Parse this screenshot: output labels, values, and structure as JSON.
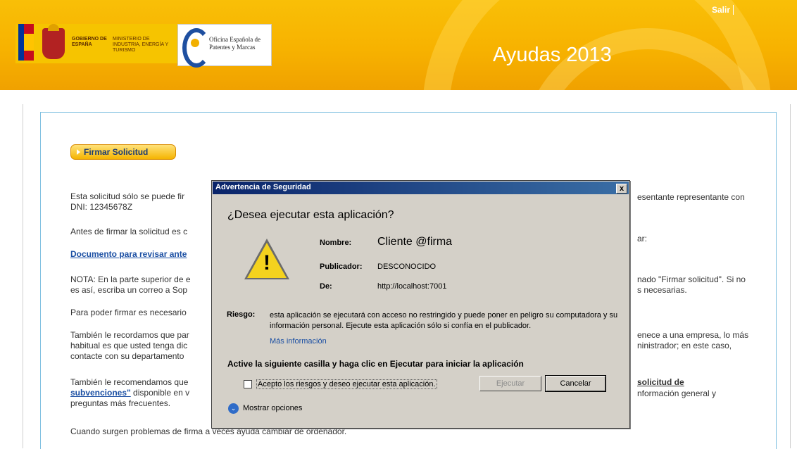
{
  "header": {
    "gobierno": "GOBIERNO DE ESPAÑA",
    "ministerio": "MINISTERIO DE INDUSTRIA, ENERGÍA Y TURISMO",
    "oepm": "Oficina Española de Patentes y Marcas",
    "title": "Ayudas 2013",
    "logout": "Salir"
  },
  "main": {
    "sign_button": "Firmar Solicitud",
    "p1_left": "Esta solicitud sólo se puede fir",
    "p1_left2": "DNI: 12345678Z",
    "p1_right": "esentante representante con",
    "p2_left": "Antes de firmar la solicitud es c",
    "p2_right": "ar:",
    "doc_link": "Documento para revisar ante",
    "nota_left1": "NOTA: En la parte superior de e",
    "nota_left2": "es así, escriba un correo a Sop",
    "nota_right1": "nado \"Firmar solicitud\". Si no",
    "nota_right2": "s necesarias.",
    "p4_left": "Para poder firmar es necesario",
    "p5_left1": "También le recordamos que par",
    "p5_left2": "habitual es que usted tenga dic",
    "p5_left3": "contacte con su departamento",
    "p5_right1": "enece a una empresa, lo más",
    "p5_right2": "ninistrador; en este caso,",
    "p6_left1": "También le recomendamos que",
    "p6_link": "subvenciones\"",
    "p6_left2": " disponible en v",
    "p6_left3": "preguntas más frecuentes.",
    "p6_right_link": "solicitud de",
    "p6_right2": "nformación general y",
    "p7_left": "Cuando surgen problemas de firma a veces ayuda cambiar de ordenador."
  },
  "dialog": {
    "title": "Advertencia de Seguridad",
    "close": "x",
    "question": "¿Desea ejecutar esta aplicación?",
    "name_label": "Nombre:",
    "name_value": "Cliente @firma",
    "publisher_label": "Publicador:",
    "publisher_value": "DESCONOCIDO",
    "from_label": "De:",
    "from_value": "http://localhost:7001",
    "risk_label": "Riesgo:",
    "risk_text": "esta aplicación se ejecutará con acceso no restringido y puede poner en peligro su computadora y su información personal. Ejecute esta aplicación sólo si confía en el publicador.",
    "more_info": "Más información",
    "instruction": "Active la siguiente casilla y haga clic en Ejecutar para iniciar la aplicación",
    "accept_label": "Acepto los riesgos y deseo ejecutar esta aplicación.",
    "run_button": "Ejecutar",
    "cancel_button": "Cancelar",
    "show_options": "Mostrar opciones"
  }
}
